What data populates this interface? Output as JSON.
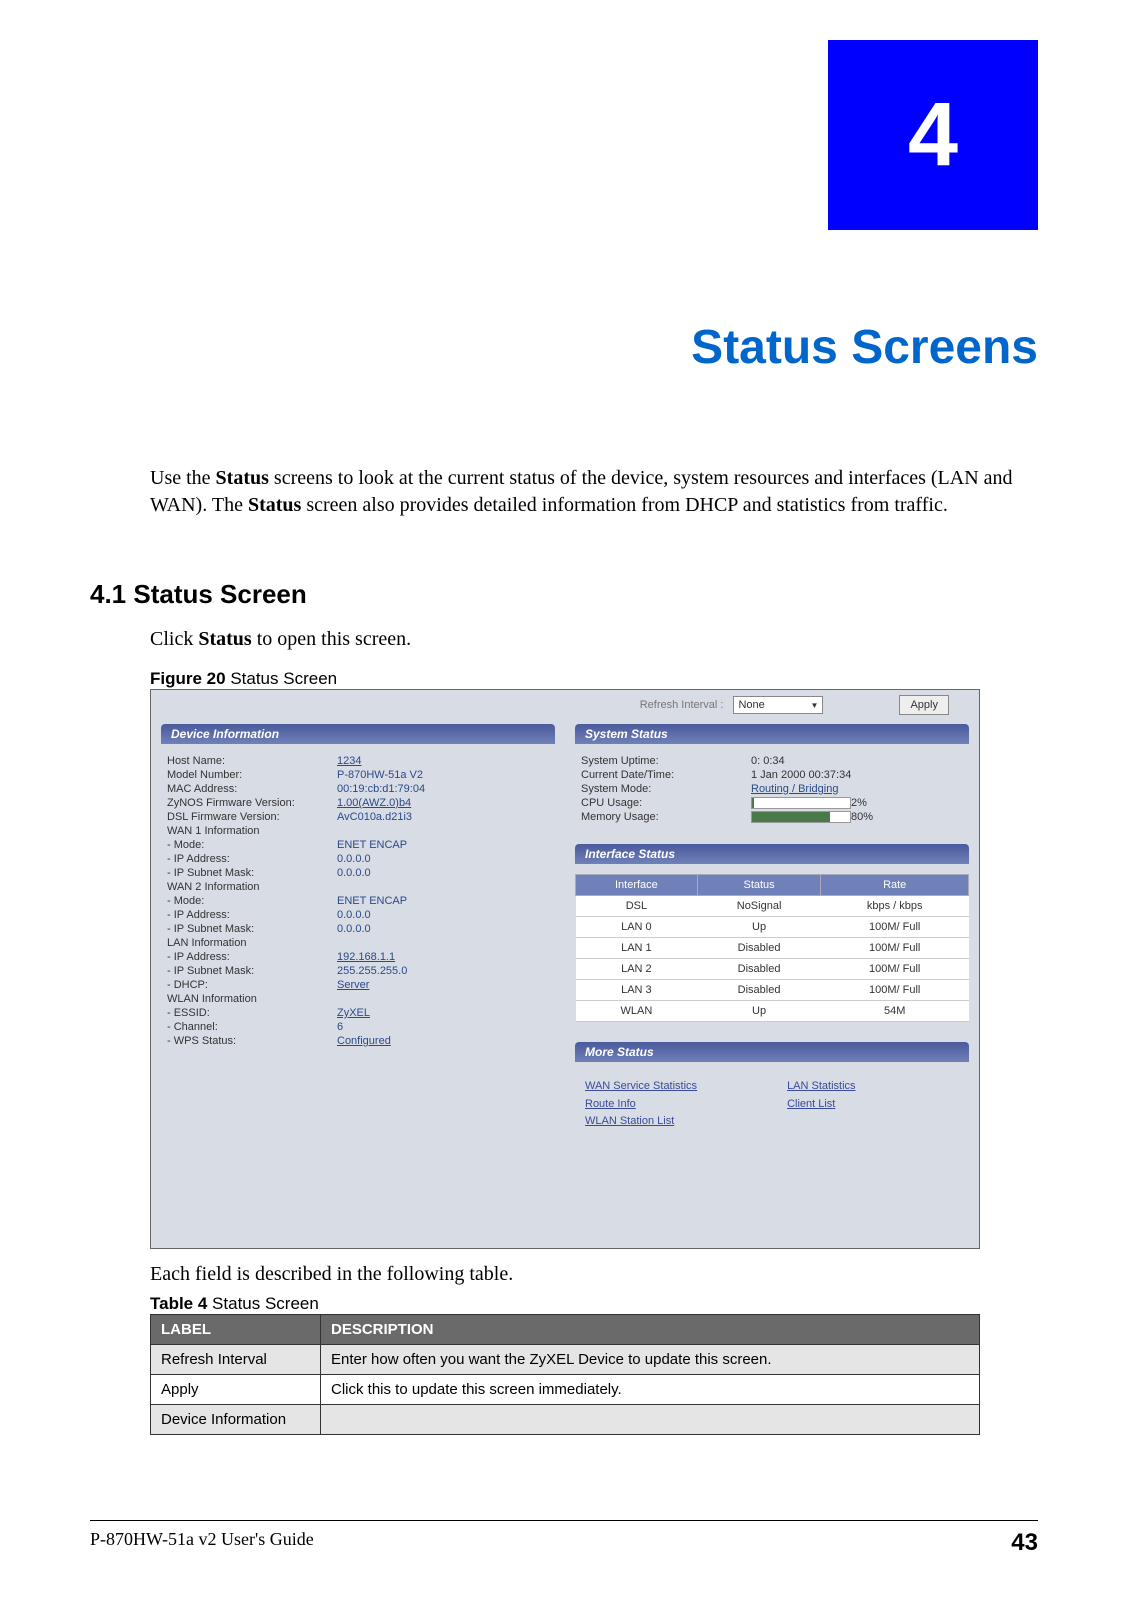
{
  "chapter": {
    "number": "4",
    "title": "Status Screens"
  },
  "intro": {
    "prefix": "Use the ",
    "bold1": "Status",
    "mid1": " screens to look at the current status of the device, system resources and interfaces (LAN and WAN). The ",
    "bold2": "Status",
    "mid2": " screen also provides detailed information from DHCP and statistics from traffic."
  },
  "section": {
    "heading": "4.1  Status Screen",
    "line_prefix": "Click ",
    "line_bold": "Status",
    "line_suffix": " to open this screen."
  },
  "figure_caption": {
    "label": "Figure 20",
    "text": "   Status Screen"
  },
  "screenshot": {
    "refresh_label": "Refresh Interval :",
    "refresh_value": "None",
    "apply_btn": "Apply",
    "panels": {
      "device_info": "Device Information",
      "system_status": "System Status",
      "interface_status": "Interface Status",
      "more_status": "More Status"
    },
    "device": [
      {
        "k": "Host Name:",
        "v": "1234",
        "link": true
      },
      {
        "k": "Model Number:",
        "v": "P-870HW-51a V2",
        "link": false
      },
      {
        "k": "MAC Address:",
        "v": "00:19:cb:d1:79:04",
        "link": false
      },
      {
        "k": "ZyNOS Firmware Version:",
        "v": "1.00(AWZ.0)b4",
        "link": true
      },
      {
        "k": "DSL Firmware Version:",
        "v": "AvC010a.d21i3",
        "link": false
      }
    ],
    "wan1_header": "WAN 1 Information",
    "wan1": [
      {
        "k": "  - Mode:",
        "v": "ENET ENCAP"
      },
      {
        "k": "  - IP Address:",
        "v": "0.0.0.0"
      },
      {
        "k": "  - IP Subnet Mask:",
        "v": "0.0.0.0"
      }
    ],
    "wan2_header": "WAN 2 Information",
    "wan2": [
      {
        "k": "  - Mode:",
        "v": "ENET ENCAP"
      },
      {
        "k": "  - IP Address:",
        "v": "0.0.0.0"
      },
      {
        "k": "  - IP Subnet Mask:",
        "v": "0.0.0.0"
      }
    ],
    "lan_header": "LAN Information",
    "lan": [
      {
        "k": "  - IP Address:",
        "v": "192.168.1.1",
        "link": true
      },
      {
        "k": "  - IP Subnet Mask:",
        "v": "255.255.255.0"
      },
      {
        "k": "  - DHCP:",
        "v": "Server",
        "link": true
      }
    ],
    "wlan_header": "WLAN Information",
    "wlan": [
      {
        "k": "  - ESSID:",
        "v": "ZyXEL",
        "link": true
      },
      {
        "k": "  - Channel:",
        "v": "6"
      },
      {
        "k": "  - WPS Status:",
        "v": "Configured",
        "link": true
      }
    ],
    "system": [
      {
        "k": "System Uptime:",
        "v": "0: 0:34"
      },
      {
        "k": "Current Date/Time:",
        "v": "1 Jan 2000 00:37:34"
      },
      {
        "k": "System Mode:",
        "v": "Routing / Bridging",
        "link": true
      }
    ],
    "cpu": {
      "k": "CPU Usage:",
      "pct": "2%",
      "fill": 2
    },
    "mem": {
      "k": "Memory Usage:",
      "pct": "80%",
      "fill": 80
    },
    "iface_headers": [
      "Interface",
      "Status",
      "Rate"
    ],
    "iface_rows": [
      [
        "DSL",
        "NoSignal",
        "kbps / kbps"
      ],
      [
        "LAN 0",
        "Up",
        "100M/ Full"
      ],
      [
        "LAN 1",
        "Disabled",
        "100M/ Full"
      ],
      [
        "LAN 2",
        "Disabled",
        "100M/ Full"
      ],
      [
        "LAN 3",
        "Disabled",
        "100M/ Full"
      ],
      [
        "WLAN",
        "Up",
        "54M"
      ]
    ],
    "more_links_left": [
      "WAN Service Statistics",
      "Route Info",
      "WLAN Station List"
    ],
    "more_links_right": [
      "LAN Statistics",
      "Client List"
    ]
  },
  "desc_intro": "Each field is described in the following table.",
  "table_caption": {
    "label": "Table 4",
    "text": "   Status Screen"
  },
  "desc_table": {
    "headers": [
      "LABEL",
      "DESCRIPTION"
    ],
    "rows": [
      [
        "Refresh Interval",
        "Enter how often you want the ZyXEL Device to update this screen."
      ],
      [
        "Apply",
        "Click this to update this screen immediately."
      ],
      [
        "Device Information",
        ""
      ]
    ]
  },
  "footer": {
    "guide": "P-870HW-51a v2 User's Guide",
    "page": "43"
  }
}
